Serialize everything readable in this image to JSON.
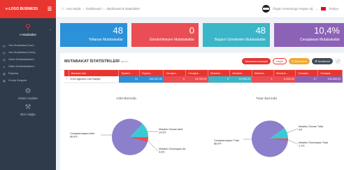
{
  "sidebar": {
    "logo_text": "e-LOGO BUSINESS",
    "module_label": "e-Mutabakat",
    "menu": [
      "Yeni Mutabakat (Cari)",
      "Yeni Mutabakat (Cebs)",
      "Gelen Mutabakatlarım",
      "Giden Mutabakatlarım",
      "Raporlar",
      "Cevap Kargular"
    ],
    "settings_label": "Sistem Ayarları",
    "tools_label": "Mizn Ulağeı"
  },
  "topbar": {
    "crumbs": [
      "Ana Sayfa",
      "Dashboard",
      "dashboard & istatistikler"
    ],
    "user_name": "Örgün Humaclogo Haşan Ağ",
    "language": "Türkçe"
  },
  "stats": [
    {
      "value": "48",
      "label": "Yollanan Mutabakatlar"
    },
    {
      "value": "0",
      "label": "Gönderilmeyen Mutabakatlar"
    },
    {
      "value": "48",
      "label": "Başarılı Gönderilen Mutabakatlar"
    },
    {
      "value": "10,4%",
      "label": "Cevaplanan Mutabakatlar"
    }
  ],
  "portlet": {
    "title": "MUTABAKAT İSTATİSTİKLERİ",
    "subtitle": "genel...",
    "btn_all": "Tamamlanmamışlar",
    "btn_status": "Hepsi",
    "btn_period": "Dönemlere",
    "btn_filter": "Sınıflandır"
  },
  "table": {
    "headers": [
      "Aksaram Adı",
      "Toplam...",
      "Toplam...",
      "Cevapla...",
      "Cevapla...",
      "Mutabık...",
      "Mutabık...",
      "Mutabık...",
      "Mutabık...",
      "Cevapla...",
      "Cevapla..."
    ],
    "rows": [
      [
        "2016 Ağustos Cari Bakiye",
        "31",
        "138.300,00",
        "4",
        "15.700,00",
        "9",
        "15.900,00",
        "1",
        "5.200,00",
        "17",
        "194.600,00"
      ]
    ]
  },
  "pies": {
    "left_title": "Adet Bazında",
    "right_title": "Tutar Bazında",
    "left_labels": {
      "main": "Cevaplanmayan Adet\n80.6%",
      "top": "Mutabık Olunan Adet\n14.5%",
      "bottom": "Mutabık Olunmayan Ad\n4.8%"
    },
    "right_labels": {
      "main": "Cevaplanmayan Tutar\n88.0%",
      "top": "Mutabık Olunan Tutar\n9%",
      "bottom": "Mutabık Olunmayan Tutar\n2.1%"
    },
    "colors": {
      "main": "#8c7fcb",
      "a": "#3bc9d6",
      "b": "#ee4c58"
    }
  }
}
